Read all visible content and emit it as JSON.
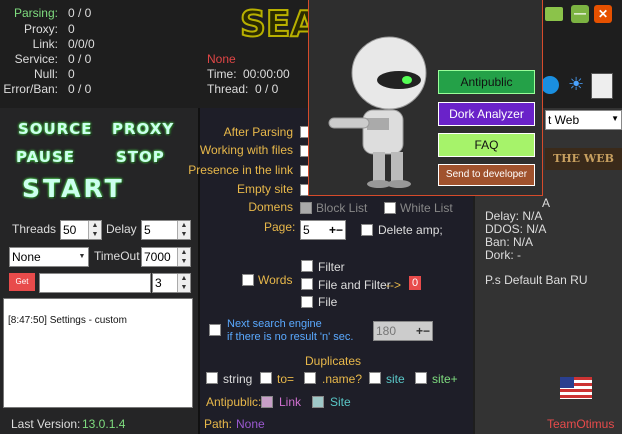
{
  "stats": {
    "parsing_label": "Parsing:",
    "parsing": "0 / 0",
    "proxy_label": "Proxy:",
    "proxy": "0",
    "link_label": "Link:",
    "link": "0/0/0",
    "service_label": "Service:",
    "service": "0 / 0",
    "null_label": "Null:",
    "null": "0",
    "error_label": "Error/Ban:",
    "error": "0 / 0"
  },
  "status": {
    "mode": "None",
    "time_label": "Time:",
    "time": "00:00:00",
    "thread_label": "Thread:",
    "thread": "0 / 0"
  },
  "banner_text": "SEA",
  "buttons": {
    "source": "SOURCE",
    "proxy": "PROXY",
    "pause": "PAUSE",
    "stop": "STOP",
    "start": "START"
  },
  "controls": {
    "threads_label": "Threads",
    "threads": "50",
    "delay_label": "Delay",
    "delay": "5",
    "engine_select": "None",
    "timeout_label": "TimeOut",
    "timeout": "7000",
    "get_label": "Get",
    "get_count": "3"
  },
  "log": "[8:47:50] Settings - custom",
  "version_label": "Last Version:",
  "version": "13.0.1.4",
  "options": {
    "after_parsing": "After Parsing",
    "working_files": "Working with files",
    "presence": "Presence in the link",
    "empty_site": "Empty site",
    "domens": "Domens",
    "block_list": "Block List",
    "white_list": "White List",
    "page_label": "Page:",
    "page": "5",
    "delete_amp": "Delete amp;",
    "words": "Words",
    "filter": "Filter",
    "file_and_filter": "File and Filter",
    "arrow": "-->",
    "filter_count": "0",
    "file": "File",
    "next_engine_1": "Next search engine",
    "next_engine_2": "if there is no result 'n' sec.",
    "next_engine_value": "180",
    "duplicates": "Duplicates",
    "string": "string",
    "to": "to=",
    "name": ".name?",
    "site": "site",
    "site_plus": "site+",
    "antipublic_label": "Antipublic:",
    "link": "Link",
    "site2": "Site",
    "path_label": "Path:",
    "path": "None"
  },
  "right": {
    "select": "t Web",
    "banner": "THE WEB",
    "info": [
      "Delay: N/A",
      "DDOS: N/A",
      "Ban: N/A",
      "Dork: -"
    ],
    "default_ban": "P.s Default Ban RU",
    "footer": "TeamOtimus",
    "a_top": "A"
  },
  "popup": {
    "antipublic": "Antipublic",
    "dork_analyzer": "Dork Analyzer",
    "faq": "FAQ",
    "send_dev": "Send to developer"
  },
  "colors": {
    "green": "#24a148",
    "purple": "#6a22c9",
    "lime": "#a6f36a",
    "brown": "#a0522d"
  }
}
